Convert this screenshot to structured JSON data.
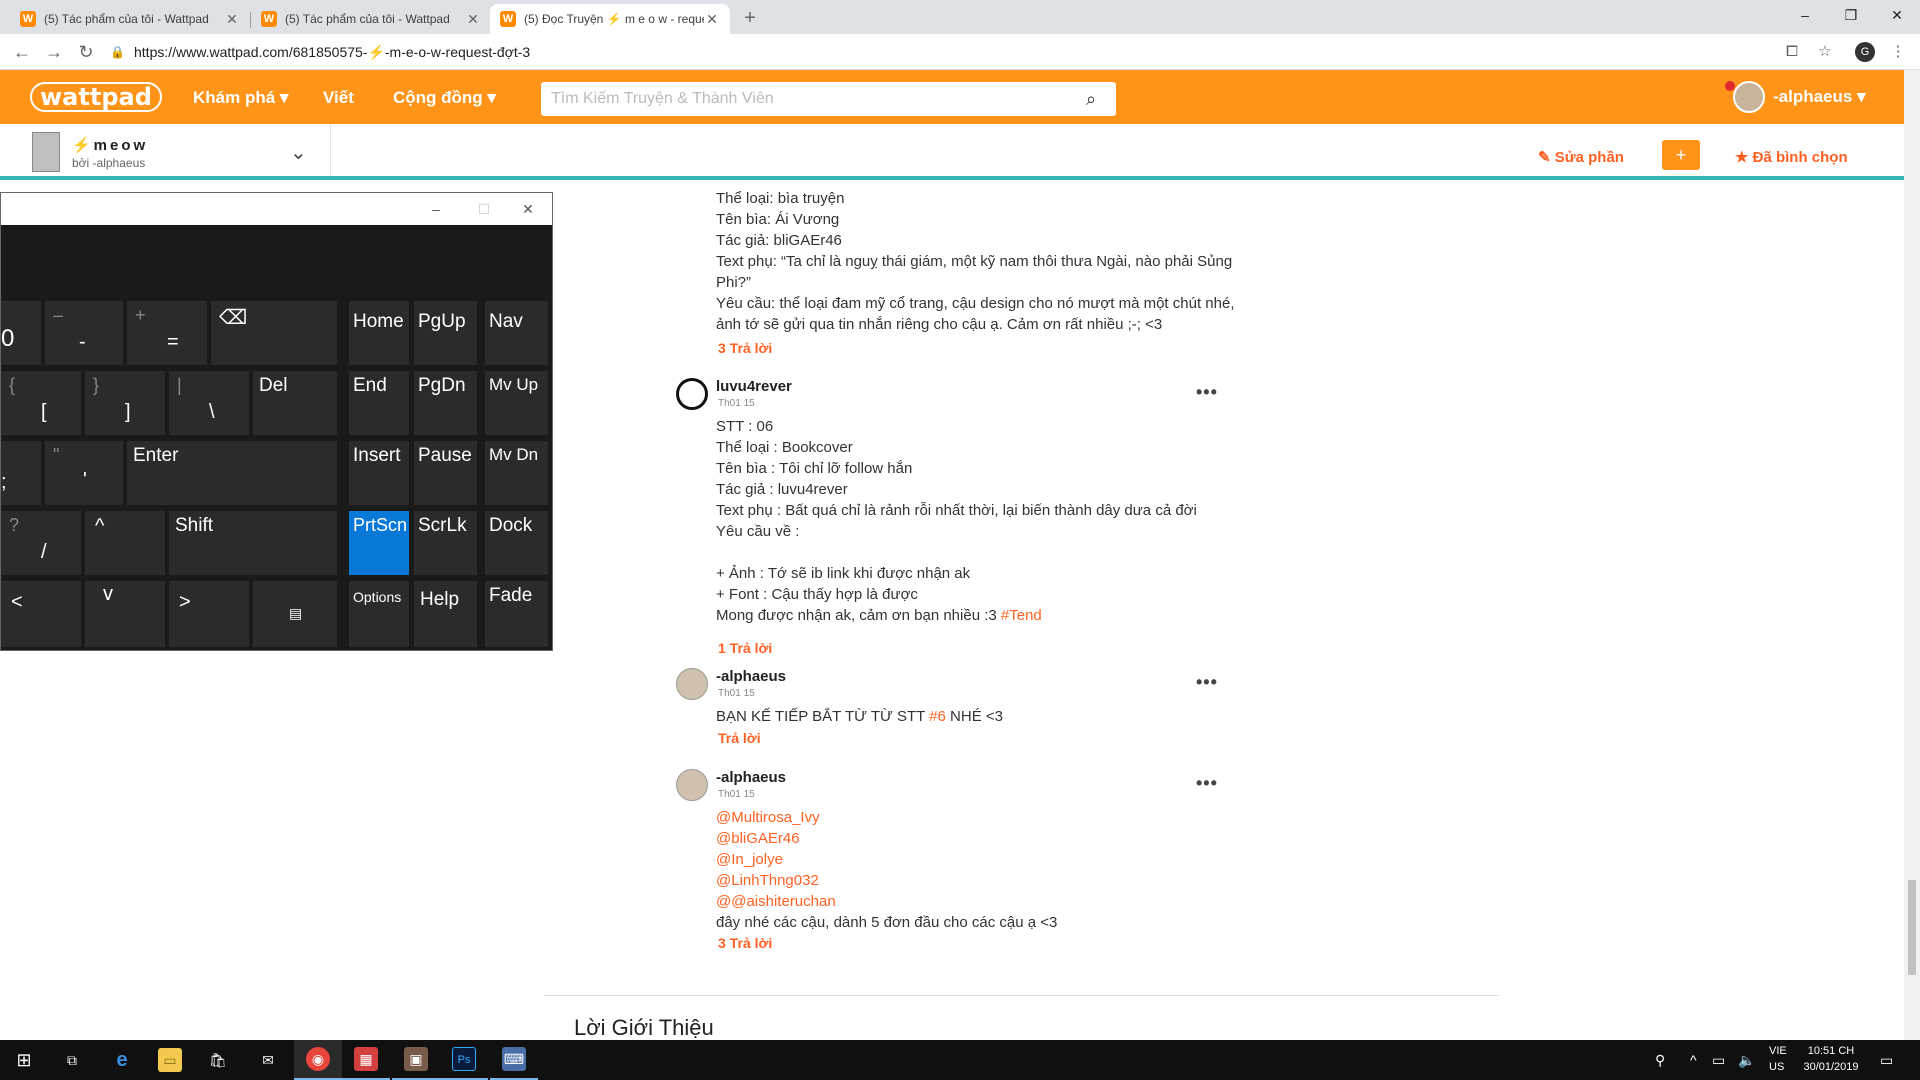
{
  "browser": {
    "tabs": [
      {
        "title": "(5) Tác phẩm của tôi - Wattpad",
        "favicon": "W",
        "active": false
      },
      {
        "title": "(5) Tác phẩm của tôi - Wattpad",
        "favicon": "W",
        "active": false
      },
      {
        "title": "(5) Đọc Truyện ⚡ m e o w - reque",
        "favicon": "W",
        "active": true
      }
    ],
    "new_tab": "+",
    "url": "https://www.wattpad.com/681850575-⚡-m-e-o-w-request-đợt-3",
    "profile_initial": "G"
  },
  "wattpad": {
    "logo": "wattpad",
    "nav": [
      {
        "label": "Khám phá ▾"
      },
      {
        "label": "Viết"
      },
      {
        "label": "Cộng đồng ▾"
      }
    ],
    "search_placeholder": "Tìm Kiếm Truyện & Thành Viên",
    "username": "-alphaeus ▾"
  },
  "story": {
    "title": "⚡meow",
    "author": "bởi -alphaeus",
    "edit_label": "Sửa phần",
    "add_label": "+",
    "voted_label": "Đã bình chọn"
  },
  "comments": [
    {
      "name": "",
      "date": "",
      "lines": [
        "Thể loại: bìa truyện",
        "Tên bìa: Ái Vương",
        "Tác giả: bliGAEr46",
        "Text phụ: “Ta chỉ là nguỵ thái giám, một kỹ nam thôi thưa Ngài, nào phải Sủng",
        "Phi?”",
        "Yêu cầu: thể loại đam mỹ cổ trang, cậu design cho nó mượt mà một chút nhé,",
        "ảnh tớ sẽ gửi qua tin nhắn riêng cho cậu ạ. Cảm ơn rất nhiều ;-; <3"
      ],
      "reply": "3 Trả lời"
    },
    {
      "name": "luvu4rever",
      "date": "Th01 15",
      "lines": [
        "STT : 06",
        "Thể loại : Bookcover",
        "Tên bìa : Tôi chỉ lỡ follow hắn",
        "Tác giả : luvu4rever",
        "Text phụ : Bất quá chỉ là rảnh rỗi nhất thời, lại biến thành dây dưa cả đời",
        "Yêu cầu về :",
        "",
        "+ Ảnh : Tớ sẽ ib link khi được nhận ak",
        "+ Font : Cậu thấy hợp là được",
        "Mong được nhận ak, cảm ơn bạn nhiều :3 "
      ],
      "hashtag": "#Tend",
      "reply": "1 Trả lời"
    },
    {
      "name": "-alphaeus",
      "date": "Th01 15",
      "text_before": "BẠN KẾ TIẾP BẮT TỪ TỪ STT ",
      "text_link": "#6",
      "text_after": " NHÉ <3",
      "reply": "Trả lời"
    },
    {
      "name": "-alphaeus",
      "date": "Th01 15",
      "mentions": [
        "@Multirosa_Ivy",
        "@bliGAEr46",
        "@In_jolye",
        "@LinhThng032",
        "@@aishiteruchan"
      ],
      "closing": "đây nhé các cậu, dành 5 đơn đầu cho các cậu ạ <3",
      "reply": "3 Trả lời"
    }
  ],
  "more_label": "•••",
  "intro_title": "Lời Giới Thiệu",
  "osk": {
    "minimize": "–",
    "maximize": "☐",
    "close": "✕",
    "keys": {
      "k0": "0",
      "minus": "-",
      "minus_sub": "–",
      "equal": "=",
      "equal_sub": "+",
      "backspace": "⌫",
      "home": "Home",
      "pgup": "PgUp",
      "nav": "Nav",
      "lbracket": "[",
      "lbracket_sub": "{",
      "rbracket": "]",
      "rbracket_sub": "}",
      "backslash": "\\",
      "backslash_sub": "|",
      "del": "Del",
      "end": "End",
      "pgdn": "PgDn",
      "mvup": "Mv Up",
      "semicolon": ";",
      "quote": "'",
      "quote_sub": "\"",
      "enter": "Enter",
      "insert": "Insert",
      "pause": "Pause",
      "mvdn": "Mv Dn",
      "slash": "/",
      "slash_sub": "?",
      "up": "^",
      "shift": "Shift",
      "prtscn": "PrtScn",
      "scrlk": "ScrLk",
      "dock": "Dock",
      "left": "<",
      "down": "v",
      "right": ">",
      "menu": "▤",
      "options": "Options",
      "help": "Help",
      "fade": "Fade"
    }
  },
  "taskbar": {
    "start": "⊞",
    "apps": [
      {
        "icon": "task-view",
        "glyph": "⧉"
      },
      {
        "icon": "edge",
        "glyph": "e"
      },
      {
        "icon": "file-explorer",
        "glyph": "▭"
      },
      {
        "icon": "store",
        "glyph": "🛍"
      },
      {
        "icon": "mail",
        "glyph": "✉"
      },
      {
        "icon": "chrome",
        "glyph": "◉"
      },
      {
        "icon": "app",
        "glyph": "▦"
      },
      {
        "icon": "photo",
        "glyph": "▣"
      },
      {
        "icon": "photoshop",
        "glyph": "Ps"
      },
      {
        "icon": "keyboard",
        "glyph": "⌨"
      }
    ],
    "lang_top": "VIE",
    "lang_bottom": "US",
    "time": "10:51 CH",
    "date": "30/01/2019",
    "notification": "▭"
  }
}
